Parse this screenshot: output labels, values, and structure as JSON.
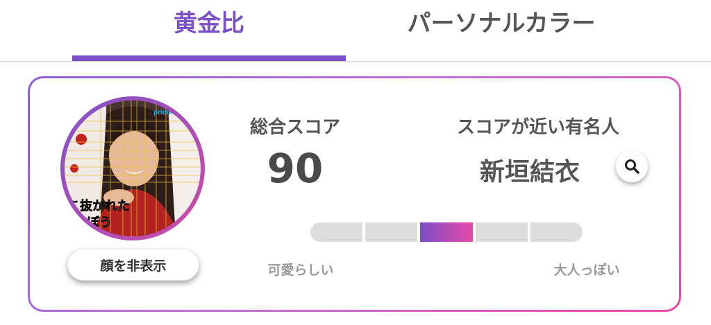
{
  "tabs": [
    {
      "label": "黄金比",
      "active": true
    },
    {
      "label": "パーソナルカラー",
      "active": false
    }
  ],
  "accent_color": "#7a4fc8",
  "gradient_colors": [
    "#7a4fc8",
    "#e84aa8"
  ],
  "photo": {
    "overlay_text_line1": "こ抜かれた",
    "overlay_text_line2": "ぼう",
    "badge_text": "prime"
  },
  "hide_face_button": "顔を非表示",
  "score": {
    "label": "総合スコア",
    "value": "90"
  },
  "celebrity": {
    "label": "スコアが近い有名人",
    "name": "新垣結衣",
    "search_icon": "search-icon"
  },
  "meter": {
    "segments": 5,
    "active_index": 2,
    "left_label": "可愛らしい",
    "right_label": "大人っぽい"
  }
}
